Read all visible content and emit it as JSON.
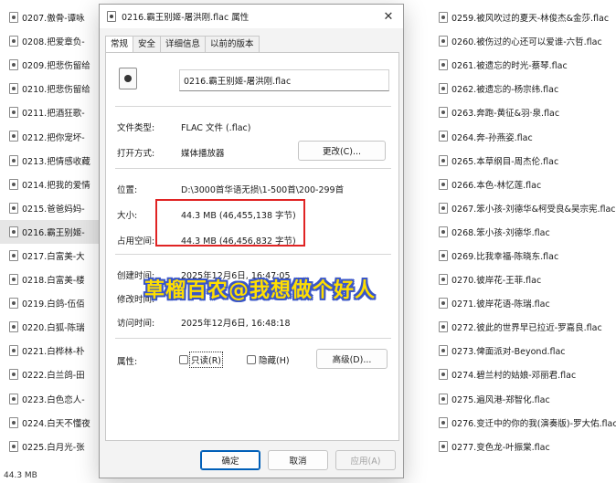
{
  "left_list": [
    {
      "name": "0207.傲骨-谭咏"
    },
    {
      "name": "0208.把爱章负-"
    },
    {
      "name": "0209.把悲伤留给"
    },
    {
      "name": "0210.把悲伤留给"
    },
    {
      "name": "0211.把酒狂歌-"
    },
    {
      "name": "0212.把你宠坏-"
    },
    {
      "name": "0213.把情感收藏"
    },
    {
      "name": "0214.把我的爱情"
    },
    {
      "name": "0215.爸爸妈妈-"
    },
    {
      "name": "0216.霸王别姬-"
    },
    {
      "name": "0217.白富美-大"
    },
    {
      "name": "0218.白富美-楼"
    },
    {
      "name": "0219.白鸽-伍佰"
    },
    {
      "name": "0220.白狐-陈瑞"
    },
    {
      "name": "0221.白桦林-朴"
    },
    {
      "name": "0222.白兰鸽-田"
    },
    {
      "name": "0223.白色恋人-"
    },
    {
      "name": "0224.白天不懂夜"
    },
    {
      "name": "0225.白月光-张"
    }
  ],
  "right_list": [
    {
      "name": "0259.被风吹过的夏天-林俊杰&金莎.flac"
    },
    {
      "name": "0260.被伤过的心还可以爱谁-六哲.flac"
    },
    {
      "name": "0261.被遗忘的时光-蔡琴.flac"
    },
    {
      "name": "0262.被遗忘的-杨宗纬.flac"
    },
    {
      "name": "0263.奔跑-黄征&羽·泉.flac"
    },
    {
      "name": "0264.奔-孙燕姿.flac"
    },
    {
      "name": "0265.本草纲目-周杰伦.flac"
    },
    {
      "name": "0266.本色-林忆莲.flac"
    },
    {
      "name": "0267.笨小孩-刘德华&柯受良&吴宗宪.flac"
    },
    {
      "name": "0268.笨小孩-刘德华.flac"
    },
    {
      "name": "0269.比我幸福-陈晓东.flac"
    },
    {
      "name": "0270.彼岸花-王菲.flac"
    },
    {
      "name": "0271.彼岸花语-陈瑞.flac"
    },
    {
      "name": "0272.彼此的世界早已拉近-罗嘉良.flac"
    },
    {
      "name": "0273.俾面派对-Beyond.flac"
    },
    {
      "name": "0274.碧兰村的姑娘-邓丽君.flac"
    },
    {
      "name": "0275.遍风港-郑智化.flac"
    },
    {
      "name": "0276.变迁中的你的我(演奏版)-罗大佑.flac"
    },
    {
      "name": "0277.变色龙-叶振棠.flac"
    }
  ],
  "status_bar": {
    "selected_size": "44.3 MB"
  },
  "dialog": {
    "title": "0216.霸王别姬-屠洪刚.flac 属性",
    "close_label": "✕",
    "tabs": [
      {
        "label": "常规",
        "active": true
      },
      {
        "label": "安全",
        "active": false
      },
      {
        "label": "详细信息",
        "active": false
      },
      {
        "label": "以前的版本",
        "active": false
      }
    ],
    "file_name": "0216.霸王别姬-屠洪刚.flac",
    "file_type_label": "文件类型:",
    "file_type_value": "FLAC 文件 (.flac)",
    "open_with_label": "打开方式:",
    "open_with_value": "媒体播放器",
    "change_button": "更改(C)...",
    "location_label": "位置:",
    "location_value": "D:\\3000首华语无损\\1-500首\\200-299首",
    "size_label": "大小:",
    "size_value": "44.3 MB (46,455,138 字节)",
    "size_on_disk_label": "占用空间:",
    "size_on_disk_value": "44.3 MB (46,456,832 字节)",
    "created_label": "创建时间:",
    "created_value": "2025年12月6日, 16:47:05",
    "modified_label": "修改时间:",
    "accessed_label": "访问时间:",
    "accessed_value": "2025年12月6日, 16:48:18",
    "attributes_label": "属性:",
    "readonly_label": "只读(R)",
    "hidden_label": "隐藏(H)",
    "advanced_button": "高级(D)...",
    "ok_button": "确定",
    "cancel_button": "取消",
    "apply_button": "应用(A)"
  },
  "watermark": {
    "text": "草榴百农@我想做个好人"
  },
  "colors": {
    "highlight_box": "#e02424",
    "primary_border": "#005fb8",
    "watermark_fill": "#ffde00",
    "watermark_stroke": "#3a56c8"
  }
}
